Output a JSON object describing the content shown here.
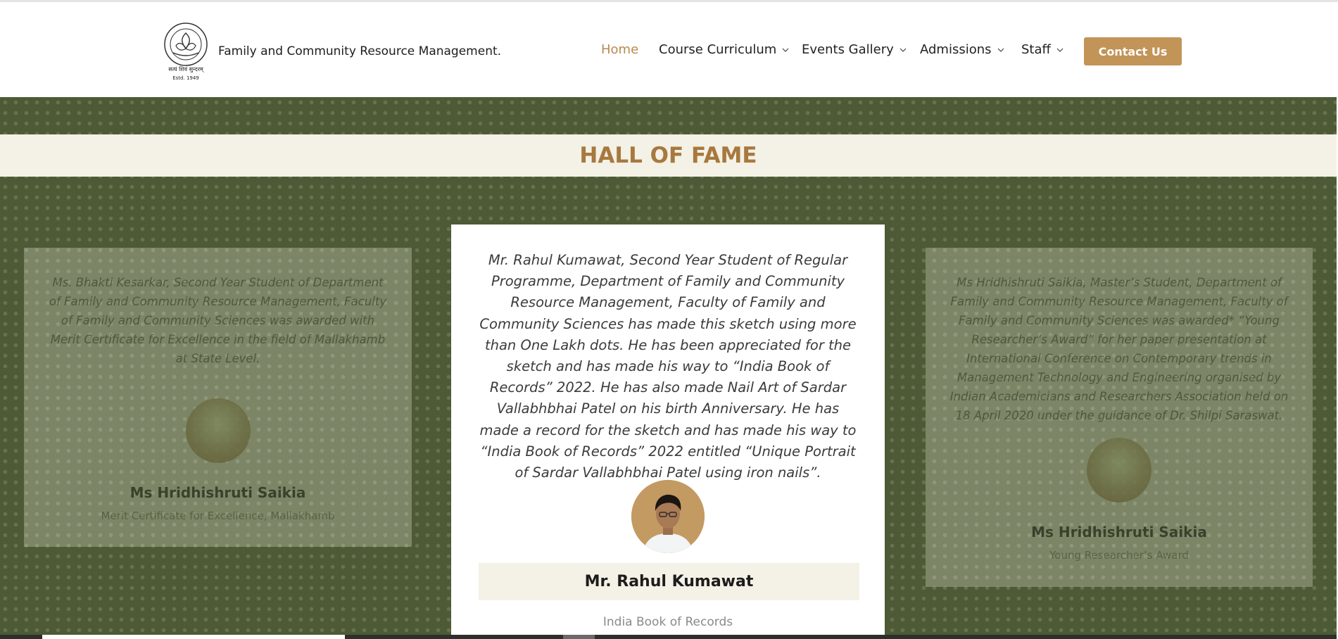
{
  "header": {
    "logo_alt": "The Maharaja Sayajirao University of Baroda emblem",
    "logo_text_top": "THE MAHARAJA SAYAJIRAO UNIVERSITY OF BARODA",
    "logo_motto": "सत्यं शिवं सुन्दरम्",
    "logo_estd": "Estd. 1949",
    "site_name": "Family and Community Resource Management.",
    "nav": [
      {
        "label": "Home",
        "active": true,
        "has_dropdown": false
      },
      {
        "label": "Course Curriculum",
        "active": false,
        "has_dropdown": true
      },
      {
        "label": "Events Gallery",
        "active": false,
        "has_dropdown": true
      },
      {
        "label": "Admissions",
        "active": false,
        "has_dropdown": true
      },
      {
        "label": "Staff",
        "active": false,
        "has_dropdown": true
      }
    ],
    "contact_label": "Contact Us"
  },
  "section": {
    "title": "HALL OF FAME",
    "cards": [
      {
        "position": "left",
        "quote": "Ms. Bhakti Kesarkar, Second Year Student of Department of Family and Community Resource Management, Faculty of Family and Community Sciences was awarded with Merit Certificate for Excellence in the field of Mallakhamb at State Level.",
        "name": "Ms Hridhishruti Saikia",
        "award": "Merit Certificate for Excellence, Mallakhamb"
      },
      {
        "position": "center",
        "quote": "Mr. Rahul Kumawat, Second Year Student of Regular Programme, Department of Family and Community Resource Management, Faculty of Family and Community Sciences has made this sketch using more than One Lakh dots. He has been appreciated for the sketch and has made his way to “India Book of Records” 2022. He has also made Nail Art of Sardar Vallabhbhai Patel on his birth Anniversary. He has made a record for the sketch and has made his way to “India Book of Records” 2022 entitled “Unique Portrait of Sardar Vallabhbhai Patel using iron nails”.",
        "name": "Mr. Rahul Kumawat",
        "award": "India Book of Records"
      },
      {
        "position": "right",
        "quote": "Ms Hridhishruti Saikia, Master’s Student, Department of Family and Community Resource Management, Faculty of Family and Community Sciences was awarded* “Young Researcher’s Award” for her paper presentation at International Conference on Contemporary trends in Management Technology and Engineering organised by Indian Academicians and Researchers Association held on 18 April 2020 under the guidance of Dr. Shilpi Saraswat.",
        "name": "Ms Hridhishruti Saikia",
        "award": "Young Researcher’s Award"
      }
    ]
  },
  "colors": {
    "accent": "#c29458",
    "section_bg": "#4d5a35",
    "band_bg": "#f4f1e6",
    "title": "#a7793f"
  }
}
